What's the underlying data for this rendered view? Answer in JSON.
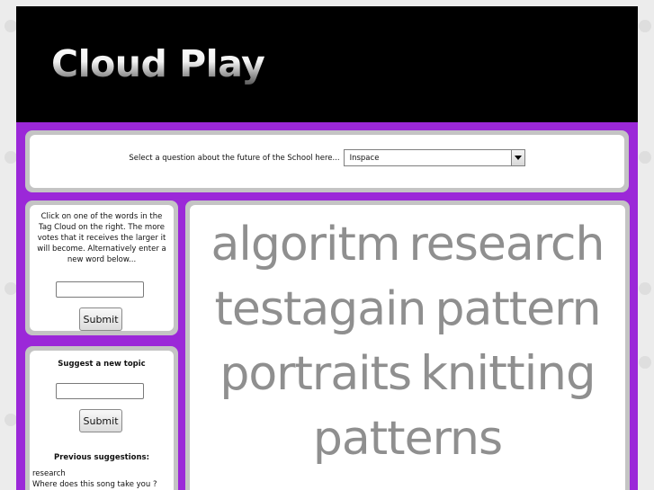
{
  "header": {
    "logo_text": "Cloud Play"
  },
  "question_bar": {
    "label": "Select a question about the future of the School here...",
    "selected_value": "Inspace",
    "dropdown_icon": "triangle-down-icon"
  },
  "vote_panel": {
    "instructions": "Click on one of the words in the Tag Cloud on the right. The more votes that it receives the larger it will become. Alternatively enter a new word below...",
    "input_value": "",
    "submit_label": "Submit"
  },
  "suggest_panel": {
    "title": "Suggest a new topic",
    "input_value": "",
    "submit_label": "Submit",
    "previous_title": "Previous suggestions:",
    "previous": [
      "research",
      "Where does this song take you ?"
    ]
  },
  "tag_cloud": {
    "lines": [
      [
        "algoritm",
        "research"
      ],
      [
        "testagain",
        "pattern"
      ],
      [
        "portraits",
        "knitting"
      ],
      [
        "patterns"
      ]
    ]
  }
}
